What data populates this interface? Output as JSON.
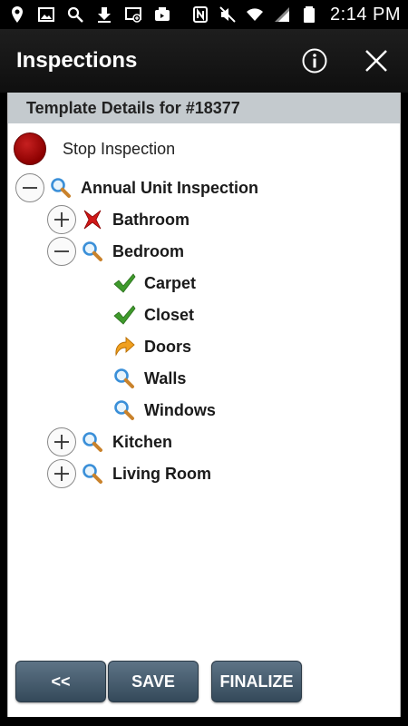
{
  "status_bar": {
    "time": "2:14 PM",
    "left_icons": [
      "location-icon",
      "gallery-icon",
      "search-icon",
      "download-icon",
      "cast-icon",
      "photo-icon"
    ],
    "right_icons": [
      "nfc-icon",
      "mute-icon",
      "wifi-icon",
      "signal-icon",
      "battery-icon"
    ]
  },
  "app_bar": {
    "title": "Inspections"
  },
  "panel": {
    "header": "Template Details for #18377",
    "stop_label": "Stop Inspection"
  },
  "tree": [
    {
      "label": "Annual Unit Inspection",
      "toggle": "minus",
      "status": "search",
      "level": 0
    },
    {
      "label": "Bathroom",
      "toggle": "plus",
      "status": "fail",
      "level": 1
    },
    {
      "label": "Bedroom",
      "toggle": "minus",
      "status": "search",
      "level": 1
    },
    {
      "label": "Carpet",
      "toggle": null,
      "status": "pass",
      "level": 2
    },
    {
      "label": "Closet",
      "toggle": null,
      "status": "pass",
      "level": 2
    },
    {
      "label": "Doors",
      "toggle": null,
      "status": "redo",
      "level": 2
    },
    {
      "label": "Walls",
      "toggle": null,
      "status": "search",
      "level": 2
    },
    {
      "label": "Windows",
      "toggle": null,
      "status": "search",
      "level": 2
    },
    {
      "label": "Kitchen",
      "toggle": "plus",
      "status": "search",
      "level": 1
    },
    {
      "label": "Living Room",
      "toggle": "plus",
      "status": "search",
      "level": 1
    }
  ],
  "footer": {
    "back_label": "<<",
    "save_label": "SAVE",
    "finalize_label": "FINALIZE"
  },
  "colors": {
    "button_top": "#5d7386",
    "button_bottom": "#34495a",
    "header_bg": "#c4cace",
    "stop_red": "#a00000"
  }
}
